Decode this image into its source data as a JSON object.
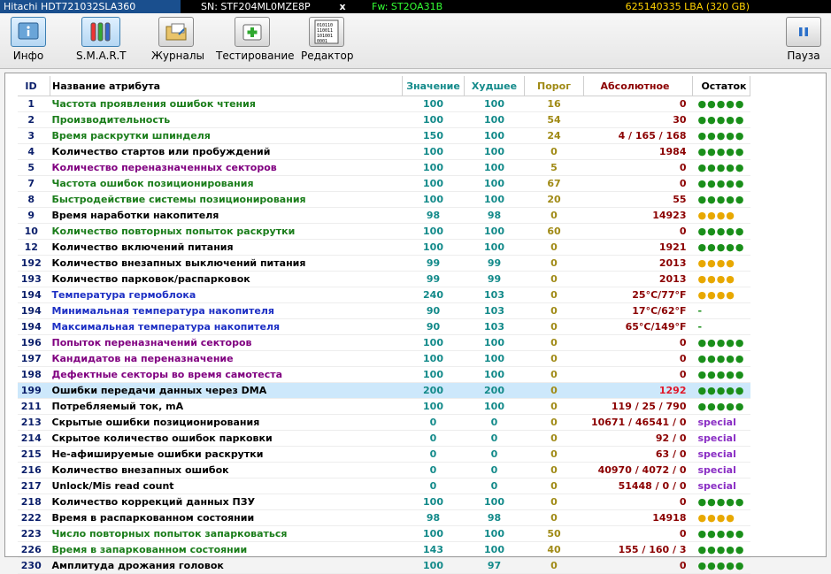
{
  "topbar": {
    "model": "Hitachi HDT721032SLA360",
    "sn": "SN: STF204ML0MZE8P",
    "close": "x",
    "fw": "Fw: ST2OA31B",
    "lba": "625140335 LBA (320 GB)"
  },
  "toolbar": {
    "info": "Инфо",
    "smart": "S.M.A.R.T",
    "logs": "Журналы",
    "test": "Тестирование",
    "editor": "Редактор",
    "pause": "Пауза",
    "editor_icon_text": "010110 110011 101001 0001"
  },
  "colors": {
    "green": "#1a7d1a",
    "black": "#000000",
    "purple": "#800080",
    "blue": "#1c2fc4"
  },
  "table": {
    "headers": {
      "id": "ID",
      "name": "Название атрибута",
      "value": "Значение",
      "worst": "Худшее",
      "threshold": "Порог",
      "raw": "Абсолютное",
      "remain": "Остаток"
    },
    "rows": [
      {
        "id": "1",
        "name": "Частота проявления ошибок чтения",
        "color": "green",
        "value": "100",
        "worst": "100",
        "threshold": "16",
        "raw": "0",
        "remain": "●●●●●",
        "remain_type": "green"
      },
      {
        "id": "2",
        "name": "Производительность",
        "color": "green",
        "value": "100",
        "worst": "100",
        "threshold": "54",
        "raw": "30",
        "remain": "●●●●●",
        "remain_type": "green"
      },
      {
        "id": "3",
        "name": "Время раскрутки шпинделя",
        "color": "green",
        "value": "150",
        "worst": "100",
        "threshold": "24",
        "raw": "4 / 165 / 168",
        "remain": "●●●●●",
        "remain_type": "green"
      },
      {
        "id": "4",
        "name": "Количество стартов или пробуждений",
        "color": "black",
        "value": "100",
        "worst": "100",
        "threshold": "0",
        "raw": "1984",
        "remain": "●●●●●",
        "remain_type": "green"
      },
      {
        "id": "5",
        "name": "Количество переназначенных секторов",
        "color": "purple",
        "value": "100",
        "worst": "100",
        "threshold": "5",
        "raw": "0",
        "remain": "●●●●●",
        "remain_type": "green"
      },
      {
        "id": "7",
        "name": "Частота ошибок позиционирования",
        "color": "green",
        "value": "100",
        "worst": "100",
        "threshold": "67",
        "raw": "0",
        "remain": "●●●●●",
        "remain_type": "green"
      },
      {
        "id": "8",
        "name": "Быстродействие системы позиционирования",
        "color": "green",
        "value": "100",
        "worst": "100",
        "threshold": "20",
        "raw": "55",
        "remain": "●●●●●",
        "remain_type": "green"
      },
      {
        "id": "9",
        "name": "Время наработки накопителя",
        "color": "black",
        "value": "98",
        "worst": "98",
        "threshold": "0",
        "raw": "14923",
        "remain": "●●●●",
        "remain_type": "yellow"
      },
      {
        "id": "10",
        "name": "Количество повторных попыток раскрутки",
        "color": "green",
        "value": "100",
        "worst": "100",
        "threshold": "60",
        "raw": "0",
        "remain": "●●●●●",
        "remain_type": "green"
      },
      {
        "id": "12",
        "name": "Количество включений питания",
        "color": "black",
        "value": "100",
        "worst": "100",
        "threshold": "0",
        "raw": "1921",
        "remain": "●●●●●",
        "remain_type": "green"
      },
      {
        "id": "192",
        "name": "Количество внезапных выключений питания",
        "color": "black",
        "value": "99",
        "worst": "99",
        "threshold": "0",
        "raw": "2013",
        "remain": "●●●●",
        "remain_type": "yellow"
      },
      {
        "id": "193",
        "name": "Количество парковок/распарковок",
        "color": "black",
        "value": "99",
        "worst": "99",
        "threshold": "0",
        "raw": "2013",
        "remain": "●●●●",
        "remain_type": "yellow"
      },
      {
        "id": "194",
        "name": "Температура гермоблока",
        "color": "blue",
        "value": "240",
        "worst": "103",
        "threshold": "0",
        "raw": "25°C/77°F",
        "remain": "●●●●",
        "remain_type": "yellow"
      },
      {
        "id": "194",
        "name": "Минимальная температура накопителя",
        "color": "blue",
        "value": "90",
        "worst": "103",
        "threshold": "0",
        "raw": "17°C/62°F",
        "remain": "-",
        "remain_type": "dash"
      },
      {
        "id": "194",
        "name": "Максимальная температура накопителя",
        "color": "blue",
        "value": "90",
        "worst": "103",
        "threshold": "0",
        "raw": "65°C/149°F",
        "remain": "-",
        "remain_type": "dash"
      },
      {
        "id": "196",
        "name": "Попыток переназначений секторов",
        "color": "purple",
        "value": "100",
        "worst": "100",
        "threshold": "0",
        "raw": "0",
        "remain": "●●●●●",
        "remain_type": "green"
      },
      {
        "id": "197",
        "name": "Кандидатов на переназначение",
        "color": "purple",
        "value": "100",
        "worst": "100",
        "threshold": "0",
        "raw": "0",
        "remain": "●●●●●",
        "remain_type": "green"
      },
      {
        "id": "198",
        "name": "Дефектные секторы во время самотеста",
        "color": "purple",
        "value": "100",
        "worst": "100",
        "threshold": "0",
        "raw": "0",
        "remain": "●●●●●",
        "remain_type": "green"
      },
      {
        "id": "199",
        "name": "Ошибки передачи данных через DMA",
        "color": "black",
        "value": "200",
        "worst": "200",
        "threshold": "0",
        "raw": "1292",
        "remain": "●●●●●",
        "remain_type": "green",
        "selected": true,
        "raw_red": true
      },
      {
        "id": "211",
        "name": "Потребляемый ток, mA",
        "color": "black",
        "value": "100",
        "worst": "100",
        "threshold": "0",
        "raw": "119 / 25 / 790",
        "remain": "●●●●●",
        "remain_type": "green"
      },
      {
        "id": "213",
        "name": "Скрытые ошибки позиционирования",
        "color": "black",
        "value": "0",
        "worst": "0",
        "threshold": "0",
        "raw": "10671 / 46541 / 0",
        "remain": "special",
        "remain_type": "special"
      },
      {
        "id": "214",
        "name": "Скрытое количество ошибок парковки",
        "color": "black",
        "value": "0",
        "worst": "0",
        "threshold": "0",
        "raw": "92 / 0",
        "remain": "special",
        "remain_type": "special"
      },
      {
        "id": "215",
        "name": "Не-афишируемые ошибки раскрутки",
        "color": "black",
        "value": "0",
        "worst": "0",
        "threshold": "0",
        "raw": "63 / 0",
        "remain": "special",
        "remain_type": "special"
      },
      {
        "id": "216",
        "name": "Количество внезапных ошибок",
        "color": "black",
        "value": "0",
        "worst": "0",
        "threshold": "0",
        "raw": "40970 / 4072 / 0",
        "remain": "special",
        "remain_type": "special"
      },
      {
        "id": "217",
        "name": "Unlock/Mis read count",
        "color": "black",
        "value": "0",
        "worst": "0",
        "threshold": "0",
        "raw": "51448 / 0 / 0",
        "remain": "special",
        "remain_type": "special"
      },
      {
        "id": "218",
        "name": "Количество коррекций данных ПЗУ",
        "color": "black",
        "value": "100",
        "worst": "100",
        "threshold": "0",
        "raw": "0",
        "remain": "●●●●●",
        "remain_type": "green"
      },
      {
        "id": "222",
        "name": "Время в распаркованном состоянии",
        "color": "black",
        "value": "98",
        "worst": "98",
        "threshold": "0",
        "raw": "14918",
        "remain": "●●●●",
        "remain_type": "yellow"
      },
      {
        "id": "223",
        "name": "Число повторных попыток запарковаться",
        "color": "green",
        "value": "100",
        "worst": "100",
        "threshold": "50",
        "raw": "0",
        "remain": "●●●●●",
        "remain_type": "green"
      },
      {
        "id": "226",
        "name": "Время в запаркованном состоянии",
        "color": "green",
        "value": "143",
        "worst": "100",
        "threshold": "40",
        "raw": "155 / 160 / 3",
        "remain": "●●●●●",
        "remain_type": "green"
      },
      {
        "id": "230",
        "name": "Амплитуда дрожания головок",
        "color": "black",
        "value": "100",
        "worst": "97",
        "threshold": "0",
        "raw": "0",
        "remain": "●●●●●",
        "remain_type": "green"
      }
    ]
  }
}
